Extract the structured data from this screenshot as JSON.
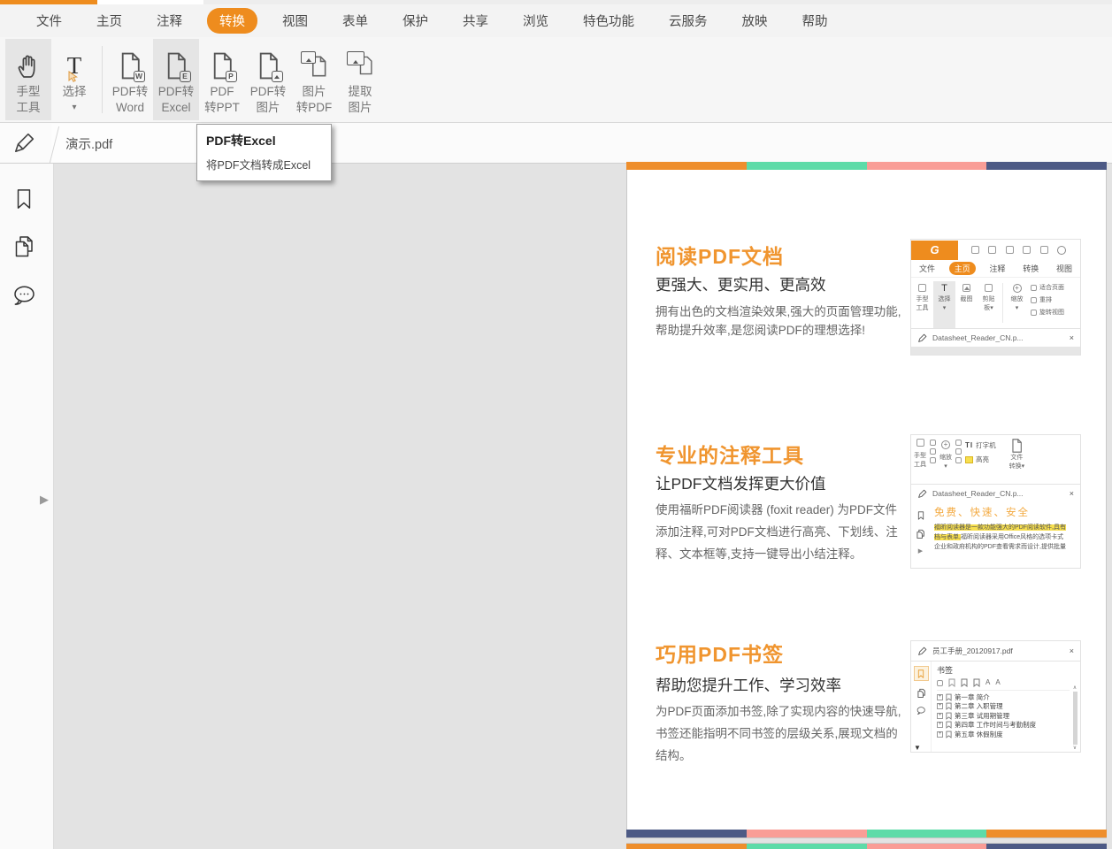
{
  "window": {
    "accent_color": "#EE8C1E"
  },
  "icons": {
    "close": "×",
    "dropdown": "▾",
    "up_arrow": "∧",
    "down_arrow": "∨",
    "tri_down": "▼",
    "tri_right": "▶",
    "select_t": "T",
    "typewriter": "TI",
    "letter_a": "A",
    "plus": "+",
    "logo_g": "G",
    "zoom_plus": "+"
  },
  "menubar": {
    "items": [
      {
        "label": "文件"
      },
      {
        "label": "主页"
      },
      {
        "label": "注释"
      },
      {
        "label": "转换",
        "active": true
      },
      {
        "label": "视图"
      },
      {
        "label": "表单"
      },
      {
        "label": "保护"
      },
      {
        "label": "共享"
      },
      {
        "label": "浏览"
      },
      {
        "label": "特色功能"
      },
      {
        "label": "云服务"
      },
      {
        "label": "放映"
      },
      {
        "label": "帮助"
      }
    ]
  },
  "toolbar": {
    "buttons": [
      {
        "line1": "手型",
        "line2": "工具"
      },
      {
        "line1": "选择",
        "line2": "▾"
      },
      {
        "line1": "PDF转",
        "line2": "Word",
        "badge": "W"
      },
      {
        "line1": "PDF转",
        "line2": "Excel",
        "badge": "E"
      },
      {
        "line1": "PDF",
        "line2": "转PPT",
        "badge": "P"
      },
      {
        "line1": "PDF转",
        "line2": "图片"
      },
      {
        "line1": "图片",
        "line2": "转PDF"
      },
      {
        "line1": "提取",
        "line2": "图片"
      }
    ]
  },
  "tooltip": {
    "title": "PDF转Excel",
    "body": "将PDF文档转成Excel"
  },
  "tabbar": {
    "document_tab": "演示.pdf"
  },
  "page": {
    "stripe_colors": {
      "orange": "#EE8E2C",
      "teal": "#5EDBA8",
      "salmon": "#F99D96",
      "navy": "#4D5A85"
    },
    "sections": [
      {
        "title": "阅读PDF文档",
        "subtitle": "更强大、更实用、更高效",
        "body": "拥有出色的文档渲染效果,强大的页面管理功能,帮助提升效率,是您阅读PDF的理想选择!"
      },
      {
        "title": "专业的注释工具",
        "subtitle": "让PDF文档发挥更大价值",
        "body": "使用福昕PDF阅读器 (foxit reader) 为PDF文件添加注释,可对PDF文档进行高亮、下划线、注释、文本框等,支持一键导出小结注释。"
      },
      {
        "title": "巧用PDF书签",
        "subtitle": "帮助您提升工作、学习效率",
        "body": "为PDF页面添加书签,除了实现内容的快速导航,书签还能指明不同书签的层级关系,展现文档的结构。"
      }
    ]
  },
  "thumb1": {
    "menu": [
      "文件",
      "主页",
      "注释",
      "转换",
      "视图"
    ],
    "active_menu": "主页",
    "tools": [
      {
        "a": "手型",
        "b": "工具"
      },
      {
        "a": "选择",
        "b": "▾"
      },
      {
        "a": "截图",
        "b": ""
      },
      {
        "a": "剪贴",
        "b": "板▾"
      },
      {
        "a": "缩放",
        "b": "▾"
      }
    ],
    "view_options": [
      "适合页面",
      "重排",
      "旋转视图"
    ],
    "tab": "Datasheet_Reader_CN.p..."
  },
  "thumb2": {
    "hand": {
      "a": "手型",
      "b": "工具"
    },
    "zoom": "缩放",
    "typewriter": "打字机",
    "highlight": "高亮",
    "convert": {
      "a": "文件",
      "b": "转换▾"
    },
    "tab": "Datasheet_Reader_CN.p...",
    "title": "免费、快速、安全",
    "line1": "福昕阅读器是一款功能强大的PDF阅读软件,具有",
    "line2_highlight": "档与表单,",
    "line2_rest": "福昕阅读器采用Office风格的选项卡式",
    "line3": "企业和政府机构的PDF查看需求而设计,提供批量"
  },
  "thumb3": {
    "tab": "员工手册_20120917.pdf",
    "panel_title": "书签",
    "items": [
      "第一章 简介",
      "第二章 入职管理",
      "第三章 试用期管理",
      "第四章 工作时间与考勤制度",
      "第五章 休假制度"
    ]
  }
}
